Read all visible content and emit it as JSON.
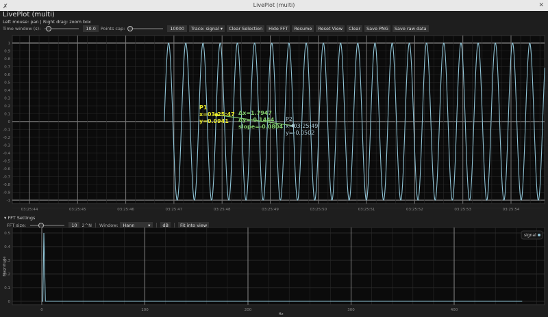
{
  "window": {
    "title": "LivePlot (multi)",
    "close": "✕"
  },
  "app": {
    "title": "LivePlot (multi)",
    "hint": "Left mouse: pan  |  Right drag: zoom box"
  },
  "toolbar": {
    "time_window_label": "Time window (s):",
    "time_window_value": "10.0",
    "time_window_fraction": 0.1,
    "points_cap_label": "Points cap:",
    "points_cap_value": "10000",
    "points_cap_fraction": 0.0,
    "trace_select": "Trace: signal",
    "buttons": [
      "Clear Selection",
      "Hide FFT",
      "Resume",
      "Reset View",
      "Clear",
      "Save PNG",
      "Save raw data"
    ]
  },
  "colors": {
    "signal": "#8fc4d6",
    "p1": "#e8e82a",
    "delta": "#7fc96b",
    "p2": "#a9c7d3",
    "background": "#0b0b0b"
  },
  "chart_data": [
    {
      "type": "line",
      "series": [
        {
          "name": "signal",
          "start": "03:25:46.8",
          "frequency_hz": 2.8,
          "amplitude": 1
        }
      ],
      "xticks": [
        "03:25:44",
        "03:25:45",
        "03:25:46",
        "03:25:47",
        "03:25:48",
        "03:25:49",
        "03:25:50",
        "03:25:51",
        "03:25:52",
        "03:25:53",
        "03:25:54"
      ],
      "yticks": [
        "1",
        "0.9",
        "0.8",
        "0.7",
        "0.6",
        "0.5",
        "0.4",
        "0.3",
        "0.2",
        "0.1",
        "0",
        "-0.1",
        "-0.2",
        "-0.3",
        "-0.4",
        "-0.5",
        "-0.6",
        "-0.7",
        "-0.8",
        "-0.9",
        "-1"
      ],
      "ylim": [
        -1.1,
        1.1
      ],
      "grid": true,
      "annotations": {
        "p1": [
          "P1",
          "x=03:25:47",
          "y=0.0941"
        ],
        "delta": [
          "Δx=1.7947",
          "Δy=-0.1444",
          "slope=-0.0804"
        ],
        "p2": [
          "P2",
          "x=03:25:49",
          "y=-0.0502"
        ]
      }
    },
    {
      "type": "line",
      "xlabel": "Hz",
      "ylabel": "Magnitude",
      "xlim": [
        -28,
        490
      ],
      "ylim": [
        0,
        0.5
      ],
      "xticks": [
        "0",
        "100",
        "200",
        "300",
        "400"
      ],
      "yticks": [
        "0.5",
        "0.4",
        "0.3",
        "0.2",
        "0.1",
        "0"
      ],
      "series": [
        {
          "name": "signal",
          "peak_hz": 2,
          "peak_value": 0.5,
          "max_hz": 466
        }
      ],
      "legend": "top-right",
      "grid": true
    }
  ],
  "fft": {
    "header": "FFT Settings",
    "size_label": "FFT size:",
    "size_value": "10",
    "size_unit": "2^N",
    "size_fraction": 0.3,
    "window_label": "Window:",
    "window_value": "Hann",
    "db": "dB",
    "fit": "Fit into view"
  }
}
